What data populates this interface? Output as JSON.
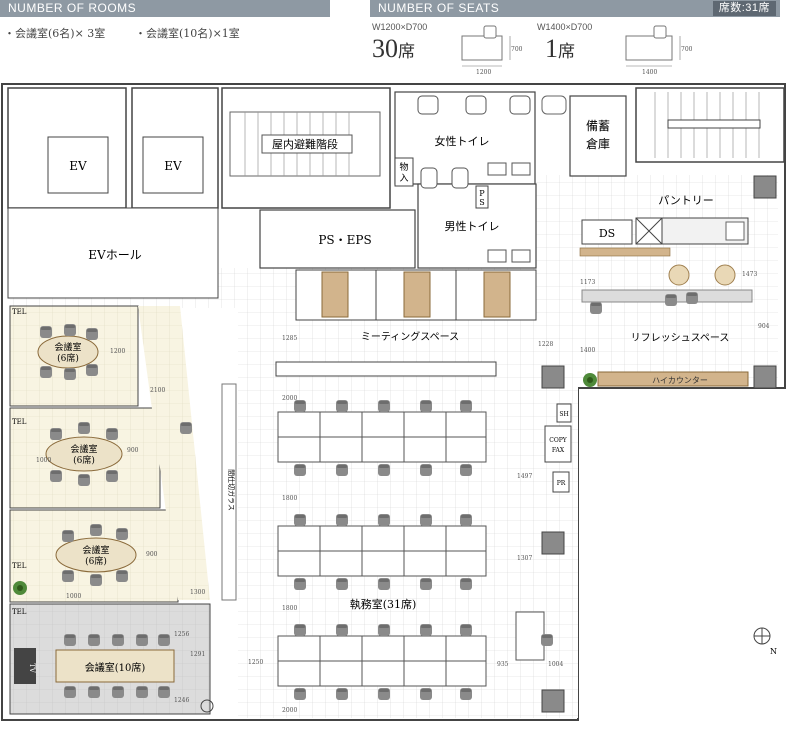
{
  "rooms_header": {
    "title": "NUMBER OF ROOMS"
  },
  "rooms": [
    {
      "label": "・会議室(6名)× 3室"
    },
    {
      "label": "・会議室(10名)×1室"
    }
  ],
  "seats_header": {
    "title": "NUMBER OF SEATS",
    "total_badge": "席数:31席"
  },
  "seat_types": [
    {
      "size": "W1200×D700",
      "count": "30",
      "unit": "席",
      "width_dim": "1200",
      "depth_dim": "700"
    },
    {
      "size": "W1400×D700",
      "count": "1",
      "unit": "席",
      "width_dim": "1400",
      "depth_dim": "700"
    }
  ],
  "plan": {
    "ev1": "EV",
    "ev2": "EV",
    "ev_hall": "EVホール",
    "stairs1": "屋内避難階段",
    "ps_eps": "PS・EPS",
    "storage_small": "物\n入",
    "ps_small": "P\nS",
    "womens_toilet": "女性トイレ",
    "mens_toilet": "男性トイレ",
    "storage": "備蓄\n倉庫",
    "pantry": "パントリー",
    "ds": "DS",
    "meeting_space": "ミーティングスペース",
    "refresh_space": "リフレッシュスペース",
    "high_counter": "ハイカウンター",
    "office": "執務室(31席)",
    "conf1": "会議室\n(6席)",
    "conf2": "会議室\n(6席)",
    "conf3": "会議室\n(6席)",
    "conf4": "会議室(10席)",
    "tel": "TEL",
    "sh": "SH",
    "copy_fax": "COPY\nFAX",
    "pr": "PR",
    "tv": "TV",
    "glass": "間仕切ガラス",
    "north": "N"
  },
  "dims": {
    "d1200": "1200",
    "d2100": "2100",
    "d900": "900",
    "d1300": "1300",
    "d1000": "1000",
    "d1285": "1285",
    "d1800": "1800",
    "d1497": "1497",
    "d1307": "1307",
    "d1473": "1473",
    "d1173": "1173",
    "d904": "904",
    "d1400": "1400",
    "d1228": "1228",
    "d935": "935",
    "d1004": "1004",
    "d1256": "1256",
    "d1291": "1291",
    "d1246": "1246",
    "d2000": "2000",
    "d1250": "1250"
  },
  "colors": {
    "header_bg": "#8e99a3",
    "conf_fill": "#f8f4e2",
    "conf10_fill": "#dcdcdc",
    "table_fill": "#ece2c8",
    "chair": "#8a8a8a",
    "wood": "#d2b48c"
  }
}
